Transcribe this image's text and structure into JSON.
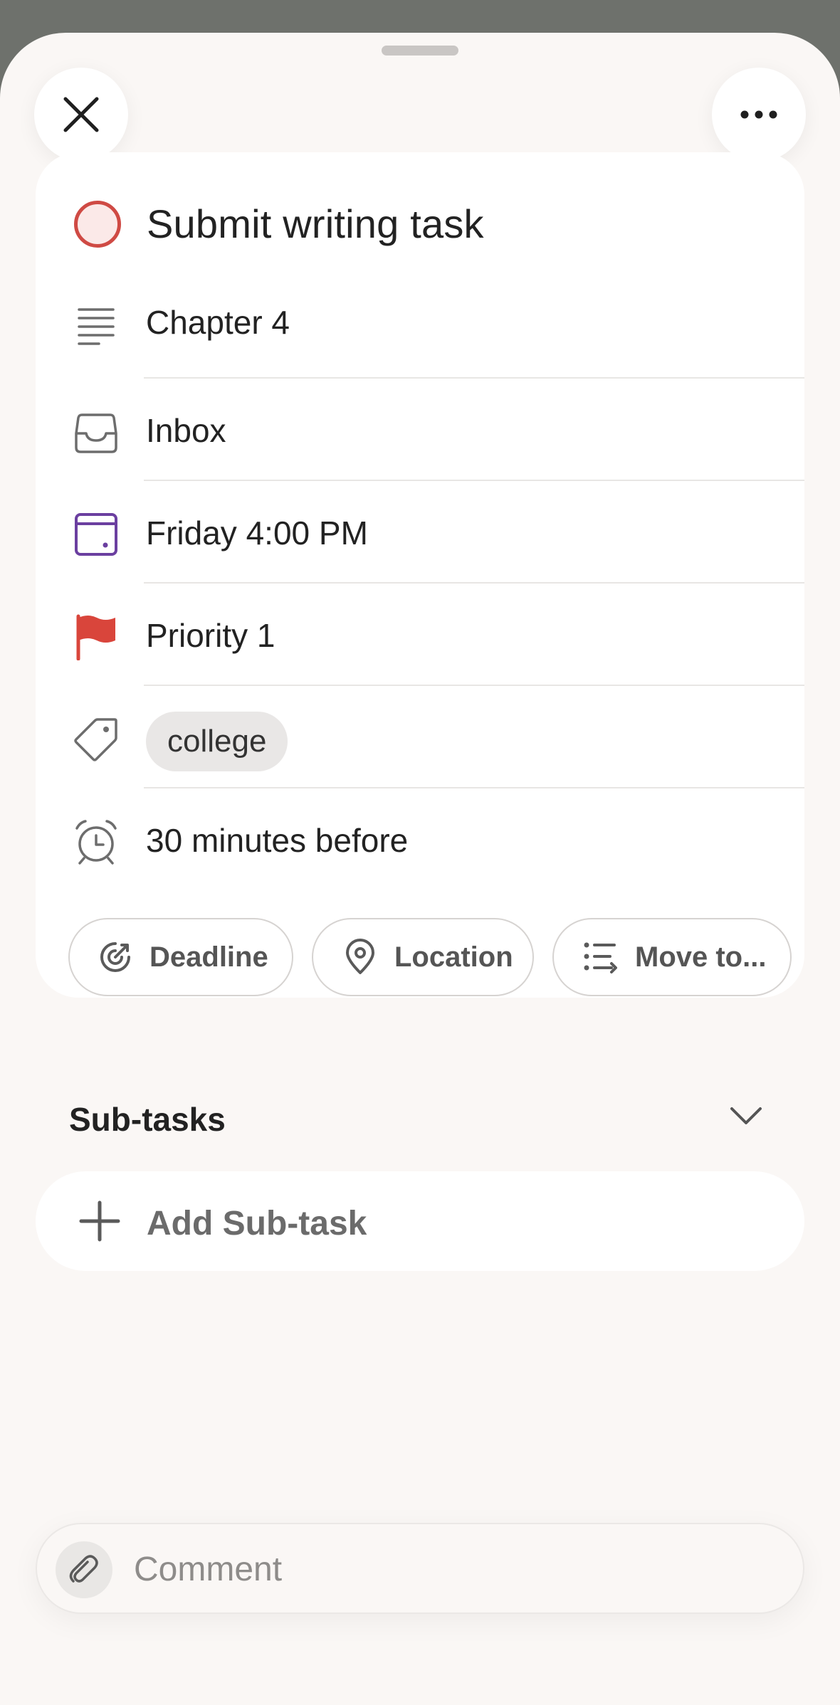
{
  "task": {
    "title": "Submit writing task",
    "description": "Chapter 4",
    "project": "Inbox",
    "due": "Friday 4:00 PM",
    "priority": "Priority 1",
    "label": "college",
    "reminder": "30 minutes before"
  },
  "actions": {
    "deadline": "Deadline",
    "location": "Location",
    "move": "Move to..."
  },
  "subtasks": {
    "heading": "Sub-tasks",
    "add_label": "Add Sub-task"
  },
  "comment": {
    "placeholder": "Comment"
  },
  "colors": {
    "priority1": "#d9453b",
    "calendar": "#6b3fa0",
    "checkbox_border": "#cf4a44"
  },
  "icons": [
    "close-icon",
    "more-icon",
    "description-icon",
    "inbox-icon",
    "calendar-icon",
    "flag-icon",
    "tag-icon",
    "alarm-icon",
    "deadline-icon",
    "location-pin-icon",
    "move-list-icon",
    "chevron-down-icon",
    "plus-icon",
    "paperclip-icon"
  ]
}
